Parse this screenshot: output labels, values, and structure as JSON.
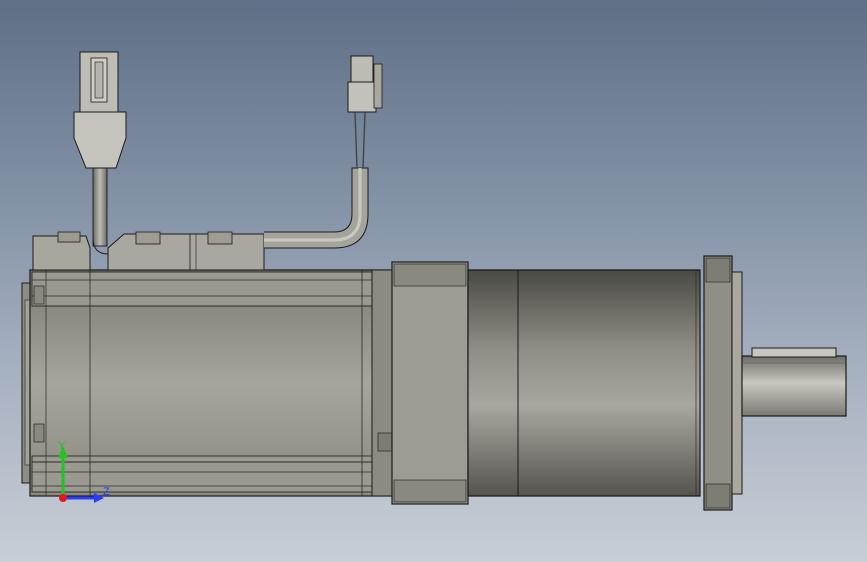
{
  "viewport": {
    "background_top": "#5f6f86",
    "background_bottom": "#c8ced6"
  },
  "triad": {
    "y_label": "Y",
    "z_label": "Z",
    "y_color": "#22c222",
    "z_color": "#2a3cff",
    "x_color": "#e01818"
  }
}
